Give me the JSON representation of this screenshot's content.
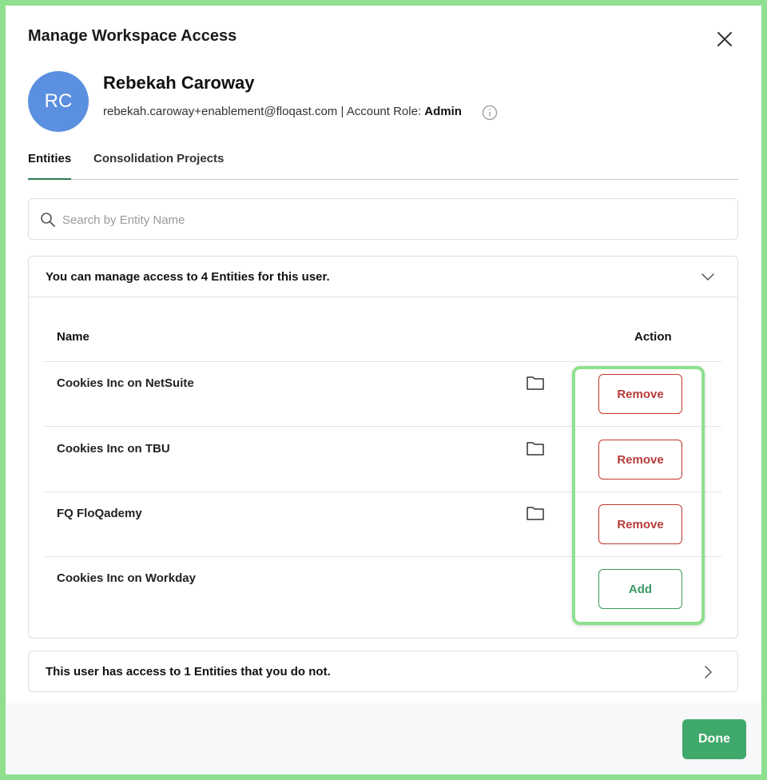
{
  "modal": {
    "title": "Manage Workspace Access",
    "close_icon": "close-icon"
  },
  "user": {
    "initials": "RC",
    "name": "Rebekah Caroway",
    "email": "rebekah.caroway+enablement@floqast.com",
    "role_label": " | Account Role: ",
    "role": "Admin",
    "avatar_color": "#5b8fdf"
  },
  "tabs": [
    {
      "label": "Entities",
      "active": true
    },
    {
      "label": "Consolidation Projects",
      "active": false
    }
  ],
  "search": {
    "placeholder": "Search by Entity Name",
    "value": ""
  },
  "entities_panel": {
    "header": "You can manage access to 4 Entities for this user.",
    "columns": {
      "name": "Name",
      "action": "Action"
    },
    "rows": [
      {
        "name": "Cookies Inc on NetSuite",
        "has_folder": true,
        "action": "Remove"
      },
      {
        "name": "Cookies Inc on TBU",
        "has_folder": true,
        "action": "Remove"
      },
      {
        "name": "FQ FloQademy",
        "has_folder": true,
        "action": "Remove"
      },
      {
        "name": "Cookies Inc on Workday",
        "has_folder": false,
        "action": "Add"
      }
    ]
  },
  "other_access_panel": {
    "text": "This user has access to 1 Entities that you do not."
  },
  "footer": {
    "done_label": "Done"
  },
  "colors": {
    "accent_green": "#3fa86b",
    "remove_red": "#b83a3a",
    "highlight": "#8ee08e"
  }
}
